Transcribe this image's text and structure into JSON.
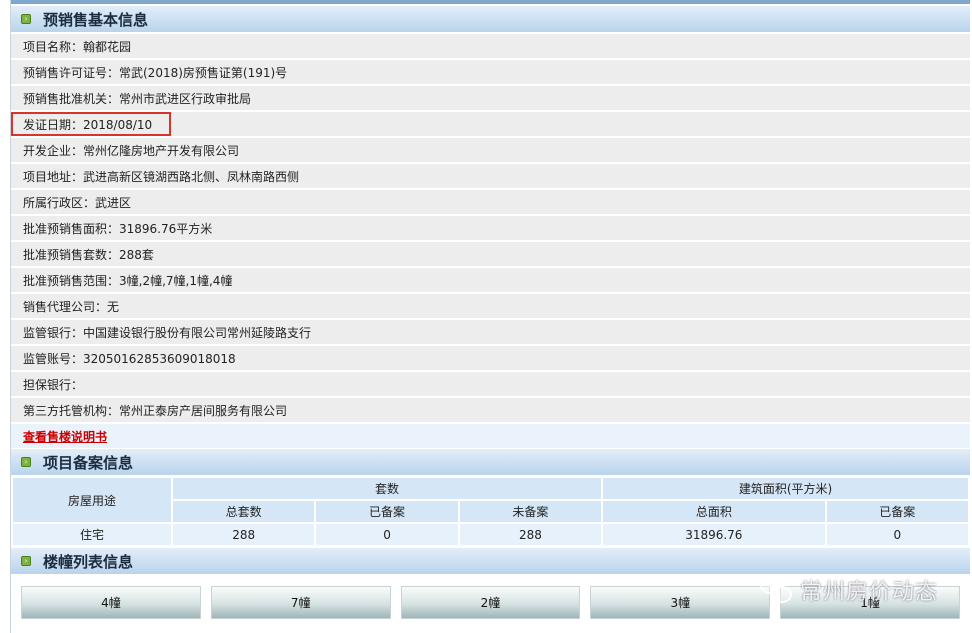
{
  "sections": {
    "basic": "预销售基本信息",
    "record": "项目备案信息",
    "buildings": "楼幢列表信息"
  },
  "info_rows": [
    "项目名称：翰都花园",
    "预销售许可证号：常武(2018)房预售证第(191)号",
    "预销售批准机关：常州市武进区行政审批局",
    "发证日期：2018/08/10",
    "开发企业：常州亿隆房地产开发有限公司",
    "项目地址：武进高新区镜湖西路北侧、凤林南路西侧",
    "所属行政区：武进区",
    "批准预销售面积：31896.76平方米",
    "批准预销售套数：288套",
    "批准预销售范围：3幢,2幢,7幢,1幢,4幢",
    "销售代理公司：无",
    "监管银行：中国建设银行股份有限公司常州延陵路支行",
    "监管账号：32050162853609018018",
    "担保银行：",
    "第三方托管机构：常州正泰房产居间服务有限公司"
  ],
  "link": "查看售楼说明书",
  "table": {
    "col_usage": "房屋用途",
    "grp_units": "套数",
    "grp_area": "建筑面积(平方米)",
    "sub": [
      "总套数",
      "已备案",
      "未备案",
      "总面积",
      "已备案"
    ],
    "rows": [
      [
        "住宅",
        "288",
        "0",
        "288",
        "31896.76",
        "0"
      ]
    ]
  },
  "buttons": [
    "4幢",
    "7幢",
    "2幢",
    "3幢",
    "1幢"
  ],
  "watermark": "常州房价动态"
}
